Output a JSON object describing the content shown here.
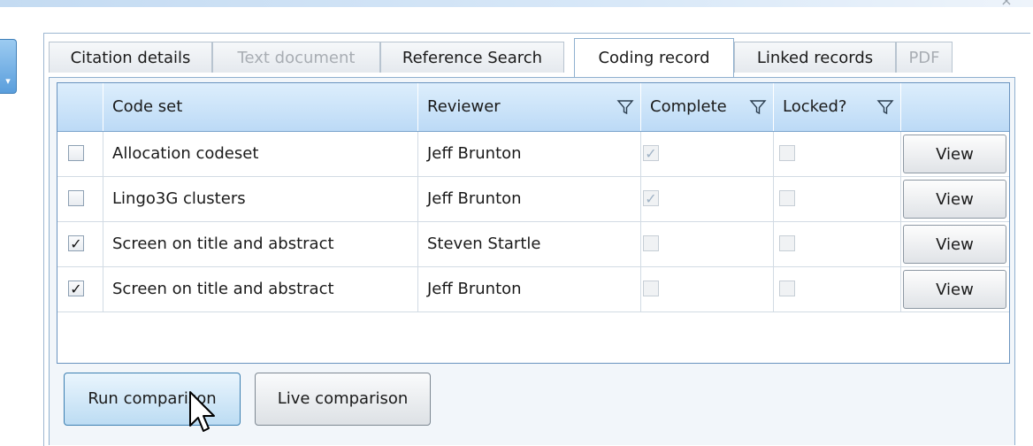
{
  "tabs": [
    {
      "label": "Citation details",
      "state": "normal"
    },
    {
      "label": "Text document",
      "state": "disabled"
    },
    {
      "label": "Reference Search",
      "state": "normal"
    },
    {
      "label": "Coding record",
      "state": "selected"
    },
    {
      "label": "Linked records",
      "state": "normal"
    },
    {
      "label": "PDF",
      "state": "disabled"
    }
  ],
  "grid": {
    "columns": {
      "code_set": "Code set",
      "reviewer": "Reviewer",
      "complete": "Complete",
      "locked": "Locked?"
    },
    "rows": [
      {
        "selected": "",
        "code_set": "Allocation codeset",
        "reviewer": "Jeff Brunton",
        "complete": "✓",
        "locked": "",
        "action": "View"
      },
      {
        "selected": "",
        "code_set": "Lingo3G clusters",
        "reviewer": "Jeff Brunton",
        "complete": "✓",
        "locked": "",
        "action": "View"
      },
      {
        "selected": "✓",
        "code_set": "Screen on title and abstract",
        "reviewer": "Steven Startle",
        "complete": "",
        "locked": "",
        "action": "View"
      },
      {
        "selected": "✓",
        "code_set": "Screen on title and abstract",
        "reviewer": "Jeff Brunton",
        "complete": "",
        "locked": "",
        "action": "View"
      }
    ]
  },
  "buttons": {
    "run_comparison": "Run comparison",
    "live_comparison": "Live comparison"
  },
  "icons": {
    "filter": "filter-funnel-icon",
    "close": "close-icon",
    "cursor": "mouse-pointer-icon"
  },
  "colors": {
    "header_gradient_top": "#ddeefc",
    "header_gradient_bottom": "#bcdaf6",
    "selected_tab_border": "#8fb0cf",
    "disabled_text": "#a8adb3",
    "hover_button_bottom": "#bcdcf3"
  }
}
